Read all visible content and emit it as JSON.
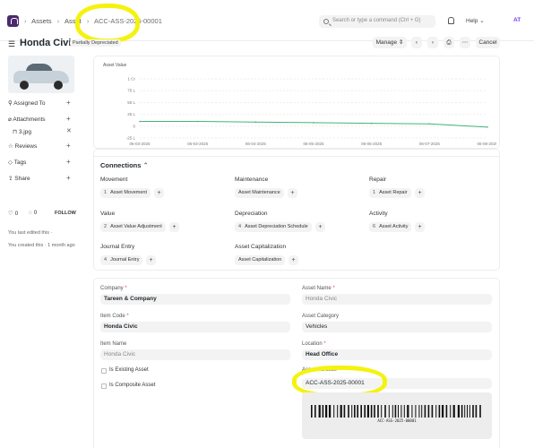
{
  "breadcrumbs": [
    "Assets",
    "Asset",
    "ACC-ASS-2025-00001"
  ],
  "search": {
    "placeholder": "Search or type a command (Ctrl + G)"
  },
  "nav": {
    "help_label": "Help",
    "avatar_initials": "AT"
  },
  "doc": {
    "title": "Honda Civic",
    "status": "Partially Depreciated"
  },
  "toolbar": {
    "manage_label": "Manage",
    "cancel_label": "Cancel"
  },
  "sidebar": {
    "assigned_to": "Assigned To",
    "attachments": "Attachments",
    "attachment_file": "3.jpg",
    "reviews": "Reviews",
    "tags": "Tags",
    "share": "Share",
    "likes": "0",
    "comments": "0",
    "follow": "FOLLOW",
    "last_edited": "You last edited this ·",
    "created": "You created this · 1 month ago"
  },
  "chart_data": {
    "type": "line",
    "title": "Asset Value",
    "x": [
      "06-03-2025",
      "06-03-2025",
      "06-04-2025",
      "06-05-2025",
      "06-06-2025",
      "06-07-2025",
      "06-08-2025"
    ],
    "series": [
      {
        "values": [
          1000000,
          1000000,
          870000,
          740000,
          610000,
          480000,
          -200000
        ]
      }
    ],
    "y_tick_labels": [
      "1 Cr",
      "75 L",
      "50 L",
      "25 L",
      "0",
      "-25 L"
    ],
    "ylim": [
      -2500000,
      10000000
    ],
    "color": "#3fb57b"
  },
  "connections": {
    "heading": "Connections",
    "groups": [
      {
        "label": "Movement",
        "items": [
          {
            "count": "1",
            "label": "Asset Movement"
          }
        ]
      },
      {
        "label": "Maintenance",
        "items": [
          {
            "count": "",
            "label": "Asset Maintenance"
          }
        ]
      },
      {
        "label": "Repair",
        "items": [
          {
            "count": "1",
            "label": "Asset Repair"
          }
        ]
      },
      {
        "label": "Value",
        "items": [
          {
            "count": "2",
            "label": "Asset Value Adjustment"
          }
        ]
      },
      {
        "label": "Depreciation",
        "items": [
          {
            "count": "4",
            "label": "Asset Depreciation Schedule"
          }
        ]
      },
      {
        "label": "Activity",
        "items": [
          {
            "count": "6",
            "label": "Asset Activity"
          }
        ]
      },
      {
        "label": "Journal Entry",
        "items": [
          {
            "count": "4",
            "label": "Journal Entry"
          }
        ]
      },
      {
        "label": "Asset Capitalization",
        "items": [
          {
            "count": "",
            "label": "Asset Capitalization"
          }
        ]
      }
    ]
  },
  "fields": {
    "company": {
      "label": "Company",
      "value": "Tareen & Company"
    },
    "item_code": {
      "label": "Item Code",
      "value": "Honda Civic"
    },
    "item_name": {
      "label": "Item Name",
      "value": "Honda Civic"
    },
    "is_existing": {
      "label": "Is Existing Asset"
    },
    "is_composite": {
      "label": "Is Composite Asset"
    },
    "asset_name": {
      "label": "Asset Name",
      "value": "Honda Civic"
    },
    "asset_category": {
      "label": "Asset Category",
      "value": "Vehicles"
    },
    "location": {
      "label": "Location",
      "value": "Head Office"
    },
    "asset_barcode": {
      "label": "Asset Barcode",
      "value": "ACC-ASS-2025-00001"
    },
    "barcode_text": "ACC-ASS-2025-00001"
  },
  "highlight_color": "#f5f20f"
}
